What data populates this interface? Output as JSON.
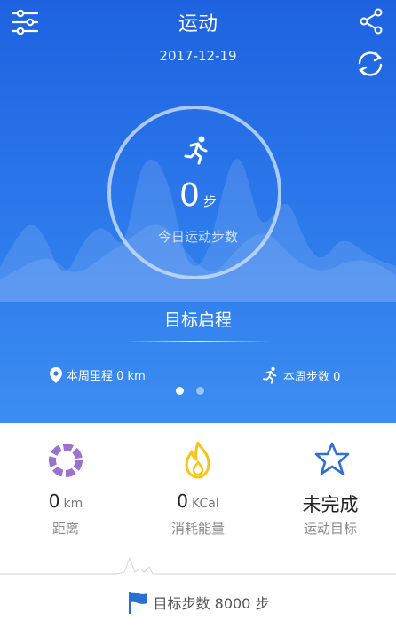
{
  "header": {
    "title": "运动",
    "date": "2017-12-19"
  },
  "today": {
    "steps": "0",
    "steps_unit": "步",
    "steps_label": "今日运动步数"
  },
  "goal_title": "目标启程",
  "week": {
    "distance_label": "本周里程 0 km",
    "steps_label": "本周步数 0"
  },
  "pager": {
    "count": 2,
    "active": 0
  },
  "stats": {
    "distance": {
      "value": "0",
      "unit": "km",
      "label": "距离"
    },
    "calories": {
      "value": "0",
      "unit": "KCal",
      "label": "消耗能量"
    },
    "goal": {
      "value": "未完成",
      "label": "运动目标"
    }
  },
  "footer": {
    "goal_steps": "目标步数 8000 步"
  },
  "colors": {
    "primary_blue": "#2a76ea",
    "ring_purple": "#9b72d0",
    "flame_yellow": "#f5c518",
    "star_blue": "#2f6fd0",
    "flag_blue": "#2a6fd6"
  },
  "icons": {
    "menu": "sliders-icon",
    "share": "share-icon",
    "sync": "sync-icon",
    "run": "runner-icon",
    "location": "location-pin-icon",
    "donut": "donut-ring-icon",
    "flame": "flame-icon",
    "star": "star-icon",
    "flag": "flag-icon"
  }
}
